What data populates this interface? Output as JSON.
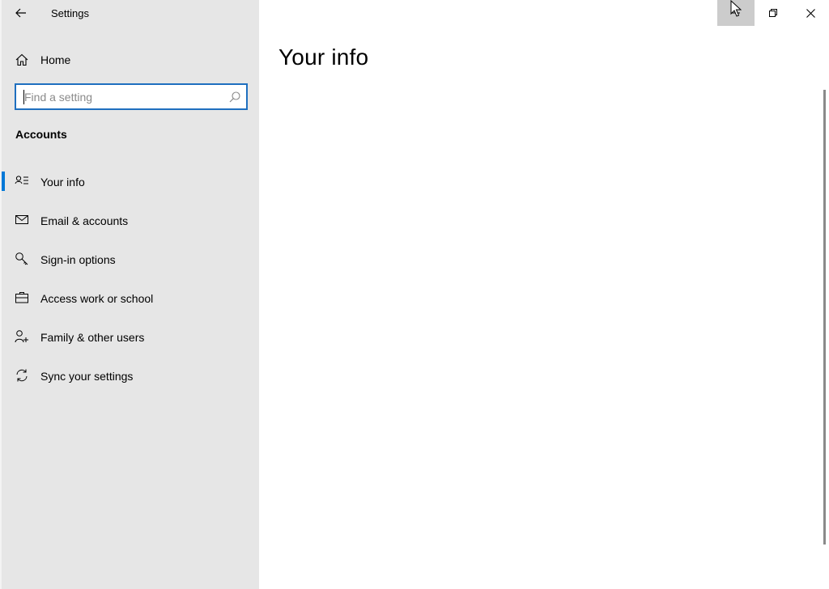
{
  "window": {
    "title": "Settings"
  },
  "sidebar": {
    "home_label": "Home",
    "search": {
      "placeholder": "Find a setting",
      "value": ""
    },
    "section_title": "Accounts",
    "items": [
      {
        "label": "Your info",
        "icon": "contact-info-icon",
        "selected": true
      },
      {
        "label": "Email & accounts",
        "icon": "mail-icon",
        "selected": false
      },
      {
        "label": "Sign-in options",
        "icon": "key-icon",
        "selected": false
      },
      {
        "label": "Access work or school",
        "icon": "briefcase-icon",
        "selected": false
      },
      {
        "label": "Family & other users",
        "icon": "add-person-icon",
        "selected": false
      },
      {
        "label": "Sync your settings",
        "icon": "sync-icon",
        "selected": false
      }
    ]
  },
  "main": {
    "page_title": "Your info"
  },
  "colors": {
    "accent": "#0078d7",
    "sidebar_bg": "#e6e6e6",
    "search_border": "#1f6fbf",
    "minimize_hover": "#cccccc"
  }
}
